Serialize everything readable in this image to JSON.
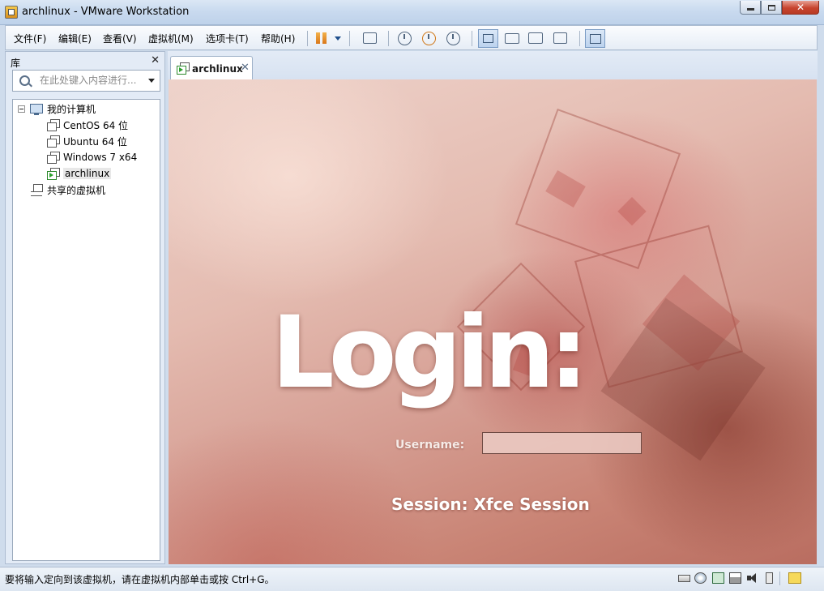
{
  "window": {
    "title": "archlinux - VMware Workstation",
    "minimize_label": "",
    "close_label": "✕"
  },
  "menu": {
    "items": [
      {
        "label": "文件(F)"
      },
      {
        "label": "编辑(E)"
      },
      {
        "label": "查看(V)"
      },
      {
        "label": "虚拟机(M)"
      },
      {
        "label": "选项卡(T)"
      },
      {
        "label": "帮助(H)"
      }
    ]
  },
  "toolbar": {
    "icons": [
      "pause-icon",
      "send-ctrl-alt-del-icon",
      "snapshot-take-icon",
      "snapshot-revert-icon",
      "snapshot-manager-icon",
      "library-view-icon",
      "console-view-icon",
      "fit-guest-icon",
      "fullscreen-icon",
      "unity-icon"
    ],
    "accent_color": "#e08a25"
  },
  "library": {
    "title": "库",
    "close_label": "✕",
    "search_placeholder": "在此处键入内容进行...",
    "tree": {
      "root_label": "我的计算机",
      "vms": [
        {
          "label": "CentOS 64 位",
          "running": false
        },
        {
          "label": "Ubuntu 64 位",
          "running": false
        },
        {
          "label": "Windows 7 x64",
          "running": false
        },
        {
          "label": "archlinux",
          "running": true
        }
      ],
      "shared_label": "共享的虚拟机"
    }
  },
  "tab": {
    "label": "archlinux",
    "close_label": "✕"
  },
  "guest": {
    "title": "Login:",
    "username_label": "Username:",
    "username_value": "",
    "session_label": "Session: Xfce Session"
  },
  "status": {
    "text": "要将输入定向到该虚拟机，请在虚拟机内部单击或按 Ctrl+G。",
    "device_icons": [
      "hard-disk-icon",
      "cd-rom-icon",
      "network-adapter-icon",
      "printer-icon",
      "sound-card-icon",
      "usb-icon",
      "message-log-icon"
    ]
  }
}
